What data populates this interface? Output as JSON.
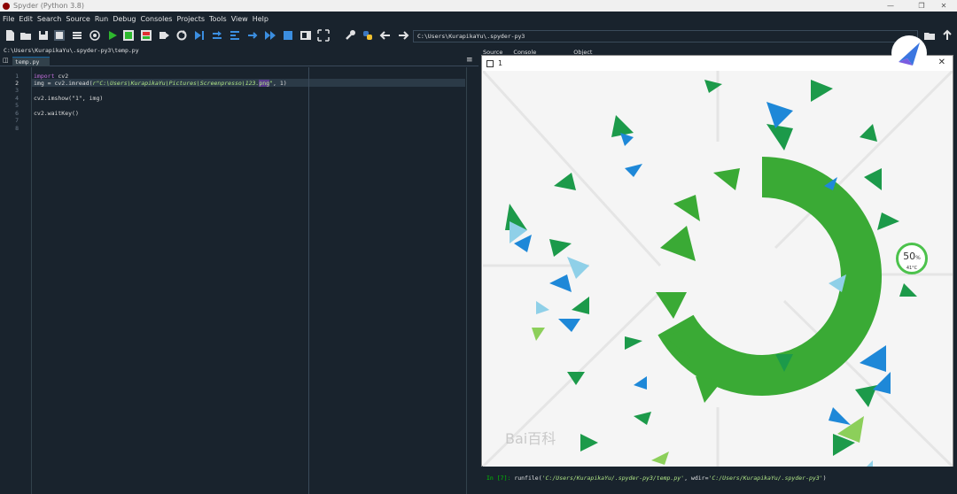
{
  "window": {
    "title": "Spyder (Python 3.8)"
  },
  "menu": [
    "File",
    "Edit",
    "Search",
    "Source",
    "Run",
    "Debug",
    "Consoles",
    "Projects",
    "Tools",
    "View",
    "Help"
  ],
  "toolbar": {
    "path": "C:\\Users\\KurapikaYu\\.spyder-py3"
  },
  "editor": {
    "filepath": "C:\\Users\\KurapikaYu\\.spyder-py3\\temp.py",
    "tab_label": "temp.py",
    "line_numbers": [
      "1",
      "2",
      "3",
      "4",
      "5",
      "6",
      "7",
      "8"
    ],
    "code": {
      "l1_kw": "import",
      "l1_rest": " cv2",
      "l2_pre": "img = cv2.imread(",
      "l2_str": "r\"C:\\Users\\KurapikaYu\\Pictures\\Screenpresso\\123.",
      "l2_hl": "png",
      "l2_str2": "\"",
      "l2_post": ", 1)",
      "l4": "cv2.imshow(\"1\", img)",
      "l6": "cv2.waitKey()"
    }
  },
  "right_tabs": [
    "Source",
    "Console",
    "Object"
  ],
  "image_window": {
    "title": "1",
    "watermark": "Bai百科"
  },
  "console": {
    "prompt": "In [7]:",
    "cmd_pre": " runfile(",
    "arg1": "'C:/Users/KurapikaYu/.spyder-py3/temp.py'",
    "mid": ", wdir=",
    "arg2": "'C:/Users/KurapikaYu/.spyder-py3'",
    "end": ")"
  },
  "widget": {
    "percent": "50",
    "percent_unit": "%",
    "temp": "41°C"
  },
  "colors": {
    "bg": "#19232d",
    "green": "#3aaa35",
    "accent": "#1464a0"
  }
}
